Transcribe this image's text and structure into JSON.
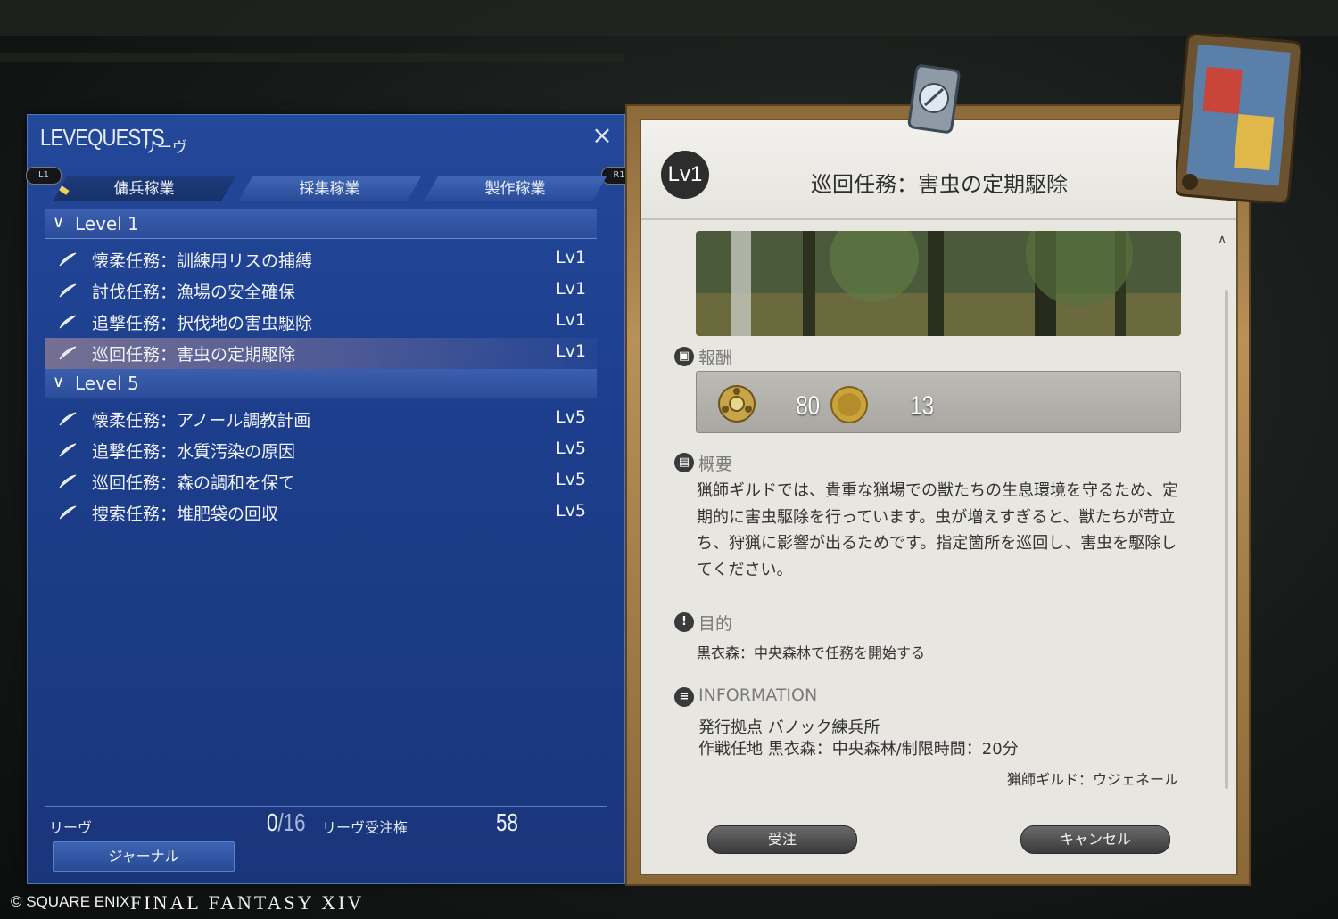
{
  "window": {
    "title": "LEVEQUESTS",
    "subtitle": "リーヴ",
    "close_icon": "×",
    "bumper_left": "L1",
    "bumper_right": "R1"
  },
  "tabs": [
    {
      "label": "傭兵稼業",
      "active": true
    },
    {
      "label": "採集稼業",
      "active": false
    },
    {
      "label": "製作稼業",
      "active": false
    }
  ],
  "groups": [
    {
      "header": "Level 1",
      "quests": [
        {
          "name": "懐柔任務：訓練用リスの捕縛",
          "level": "Lv1",
          "selected": false
        },
        {
          "name": "討伐任務：漁場の安全確保",
          "level": "Lv1",
          "selected": false
        },
        {
          "name": "追撃任務：択伐地の害虫駆除",
          "level": "Lv1",
          "selected": false
        },
        {
          "name": "巡回任務：害虫の定期駆除",
          "level": "Lv1",
          "selected": true
        }
      ]
    },
    {
      "header": "Level 5",
      "quests": [
        {
          "name": "懐柔任務：アノール調教計画",
          "level": "Lv5",
          "selected": false
        },
        {
          "name": "追撃任務：水質汚染の原因",
          "level": "Lv5",
          "selected": false
        },
        {
          "name": "巡回任務：森の調和を保て",
          "level": "Lv5",
          "selected": false
        },
        {
          "name": "捜索任務：堆肥袋の回収",
          "level": "Lv5",
          "selected": false
        }
      ]
    }
  ],
  "footer": {
    "leve_label": "リーヴ",
    "leve_count": "0",
    "leve_max": "/16",
    "allowance_label": "リーヴ受注権",
    "allowance_value": "58",
    "journal_button": "ジャーナル"
  },
  "detail": {
    "level_badge": "Lv1",
    "title": "巡回任務：害虫の定期駆除",
    "reward_label": "報酬",
    "reward_exp": "80",
    "reward_gil": "13",
    "summary_label": "概要",
    "summary_text": "猟師ギルドでは、貴重な猟場での獣たちの生息環境を守るため、定期的に害虫駆除を行っています。虫が増えすぎると、獣たちが苛立ち、狩猟に影響が出るためです。指定箇所を巡回し、害虫を駆除してください。",
    "objective_label": "目的",
    "objective_text": "黒衣森：中央森林で任務を開始する",
    "info_label": "INFORMATION",
    "info_issuer": "発行拠点 バノック練兵所",
    "info_area": "作戦任地 黒衣森：中央森林/制限時間：20分",
    "info_client": "猟師ギルド：ウジェネール",
    "accept_button": "受注",
    "cancel_button": "キャンセル"
  },
  "branding": {
    "copyright": "© SQUARE ENIX",
    "logo": "FINAL FANTASY XIV"
  },
  "colors": {
    "panel_blue": "#1d3f8e",
    "detail_bg": "#e8e6e0",
    "frame_gold": "#b89058"
  }
}
